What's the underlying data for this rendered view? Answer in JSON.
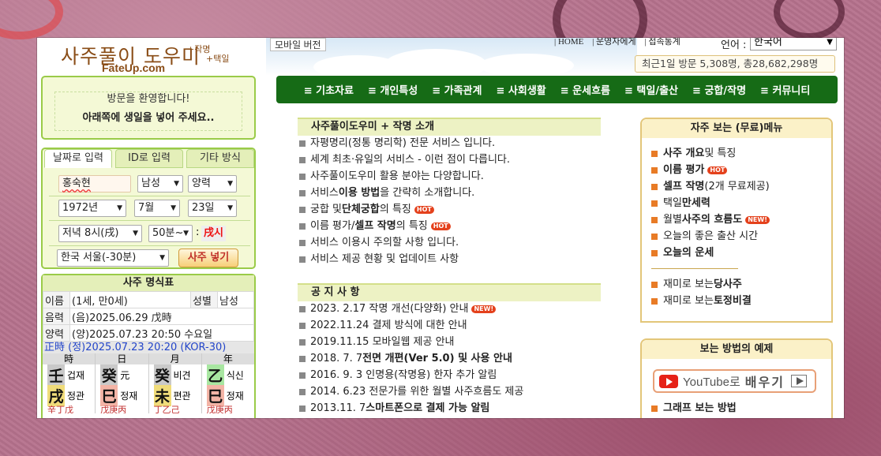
{
  "header": {
    "logo_main": "사주풀이 도우미",
    "logo_sub1": "+작명",
    "logo_sub2": "+택일",
    "logo_url": "FateUp.com",
    "mobile_label": "모바일 버전",
    "top_links": [
      "| HOME",
      "| 운영자에게",
      "| 접속통계"
    ],
    "lang_label": "언어 :",
    "lang_value": "한국어",
    "visit_text": "최근1일 방문 5,308명, 총28,682,298명"
  },
  "nav": {
    "items": [
      "≡ 기초자료",
      "≡ 개인특성",
      "≡ 가족관계",
      "≡ 사회생활",
      "≡ 운세흐름",
      "≡ 택일/출산",
      "≡ 궁합/작명",
      "≡ 커뮤니티"
    ]
  },
  "welcome": {
    "line1": "방문을 환영합니다!",
    "line2": "아래쪽에 생일을 넣어 주세요.."
  },
  "input_panel": {
    "tabs": [
      "날짜로 입력",
      "ID로 입력",
      "기타 방식"
    ],
    "name": "홍숙현",
    "gender": "남성",
    "calendar": "양력",
    "year": "1972년",
    "month": "7월",
    "day": "23일",
    "hour": "저녁 8시(戌)",
    "minute": "50분~",
    "colon": ":",
    "hour_branch": "戌시",
    "region": "한국 서울(-30분)",
    "submit": "사주 넣기"
  },
  "saju": {
    "title": "사주 명식표",
    "name_label": "이름",
    "name_value": "(1세, 만0세)",
    "gender_label": "성별",
    "gender_value": "남성",
    "lunar_label": "음력",
    "lunar_value": "(음)2025.06.29 戊時",
    "solar_label": "양력",
    "solar_value": "(양)2025.07.23 20:50 수요일",
    "standard_line": "正時 (정)2025.07.23 20:20 (KOR-30)",
    "pillars": [
      {
        "head": "時",
        "stem": "壬",
        "stem_god": "겁재",
        "branch": "戌",
        "branch_god": "정관",
        "foot": "辛丁戊"
      },
      {
        "head": "日",
        "stem": "癸",
        "stem_god": "元",
        "branch": "巳",
        "branch_god": "정재",
        "foot": "戊庚丙"
      },
      {
        "head": "月",
        "stem": "癸",
        "stem_god": "비견",
        "branch": "未",
        "branch_god": "편관",
        "foot": "丁乙己"
      },
      {
        "head": "年",
        "stem": "乙",
        "stem_god": "식신",
        "branch": "巳",
        "branch_god": "정재",
        "foot": "戊庚丙"
      }
    ],
    "colors": {
      "stem_water": "#c9c9c9",
      "branch_fire": "#f3b4a6",
      "branch_earth": "#f0dc7a",
      "stem_wood": "#a8e6a1"
    }
  },
  "intro": {
    "title": "사주풀이도우미 + 작명 소개",
    "items": [
      {
        "pre": "자평명리(정통 명리학) 전문 서비스 입니다.",
        "bold": "",
        "post": "",
        "hot": false
      },
      {
        "pre": "세계 최초·유일의 서비스 - 이런 점이 다릅니다.",
        "bold": "",
        "post": "",
        "hot": false
      },
      {
        "pre": "사주풀이도우미 활용 분야는 다양합니다.",
        "bold": "",
        "post": "",
        "hot": false
      },
      {
        "pre": "서비스 ",
        "bold": "이용 방법",
        "post": "을 간략히 소개합니다.",
        "hot": false
      },
      {
        "pre": "궁합 및 ",
        "bold": "단체궁합",
        "post": "의 특징",
        "hot": true
      },
      {
        "pre": "이름 평가/",
        "bold": "셀프 작명",
        "post": "의 특징",
        "hot": true
      },
      {
        "pre": "서비스 이용시 주의할 사항 입니다.",
        "bold": "",
        "post": "",
        "hot": false
      },
      {
        "pre": "서비스 제공 현황 및 업데이트 사항",
        "bold": "",
        "post": "",
        "hot": false
      }
    ]
  },
  "notices": {
    "title": "공 지 사 항",
    "items": [
      {
        "pre": "2023. 2.17 작명 개선(다양화) 안내",
        "bold": "",
        "new": true
      },
      {
        "pre": "2022.11.24 결제 방식에 대한 안내",
        "bold": "",
        "new": false
      },
      {
        "pre": "2019.11.15 모바일웹 제공 안내",
        "bold": "",
        "new": false
      },
      {
        "pre": "2018. 7. 7 ",
        "bold": "전면 개편(Ver 5.0) 및 사용 안내",
        "new": false
      },
      {
        "pre": "2016. 9. 3 인명용(작명용) 한자 추가 알림",
        "bold": "",
        "new": false
      },
      {
        "pre": "2014. 6.23 전문가를 위한 월별 사주흐름도 제공",
        "bold": "",
        "new": false
      },
      {
        "pre": "2013.11. 7 ",
        "bold": "스마트폰으로 결제 가능 알림",
        "new": false
      }
    ]
  },
  "free_menu": {
    "title": "자주 보는 (무료)메뉴",
    "items": [
      {
        "pre": "",
        "bold": "사주 개요",
        "post": " 및 특징",
        "badge": ""
      },
      {
        "pre": "",
        "bold": "이름 평가",
        "post": "",
        "badge": "HOT"
      },
      {
        "pre": "",
        "bold": "셀프 작명",
        "post": "(2개 무료제공)",
        "badge": ""
      },
      {
        "pre": "택일 ",
        "bold": "만세력",
        "post": "",
        "badge": ""
      },
      {
        "pre": "월별 ",
        "bold": "사주의 흐름도",
        "post": "",
        "badge": "NEW!"
      },
      {
        "pre": "오늘의 좋은 출산 시간",
        "bold": "",
        "post": "",
        "badge": ""
      },
      {
        "pre": "",
        "bold": "오늘의 운세",
        "post": "",
        "badge": ""
      }
    ],
    "extra": [
      {
        "pre": "재미로 보는 ",
        "bold": "당사주"
      },
      {
        "pre": "재미로 보는 ",
        "bold": "토정비결"
      }
    ]
  },
  "howto": {
    "title": "보는 방법의 예제",
    "yt_text": "YouTube로",
    "yt_cta": "배우기",
    "items": [
      {
        "pre": "",
        "bold": "그래프 보는 방법"
      }
    ]
  },
  "badges": {
    "hot": "HOT",
    "new": "NEW!"
  }
}
